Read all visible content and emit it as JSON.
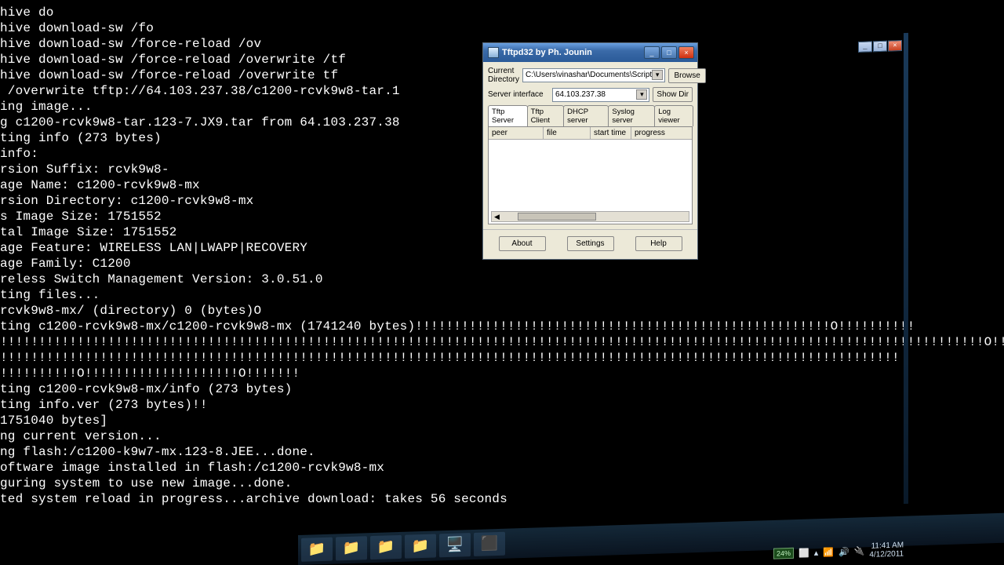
{
  "terminal_lines": [
    "hive do",
    "hive download-sw /fo",
    "hive download-sw /force-reload /ov",
    "hive download-sw /force-reload /overwrite /tf",
    "hive download-sw /force-reload /overwrite tf",
    " /overwrite tftp://64.103.237.38/c1200-rcvk9w8-tar.1",
    "ing image...",
    "g c1200-rcvk9w8-tar.123-7.JX9.tar from 64.103.237.38",
    "ting info (273 bytes)",
    "info:",
    "rsion Suffix: rcvk9w8-",
    "age Name: c1200-rcvk9w8-mx",
    "rsion Directory: c1200-rcvk9w8-mx",
    "s Image Size: 1751552",
    "tal Image Size: 1751552",
    "age Feature: WIRELESS LAN|LWAPP|RECOVERY",
    "age Family: C1200",
    "reless Switch Management Version: 3.0.51.0",
    "ting files...",
    "rcvk9w8-mx/ (directory) 0 (bytes)O",
    "ting c1200-rcvk9w8-mx/c1200-rcvk9w8-mx (1741240 bytes)!!!!!!!!!!!!!!!!!!!!!!!!!!!!!!!!!!!!!!!!!!!!!!!!!!!!!!O!!!!!!!!!!",
    "!!!!!!!!!!!!!!!!!!!!!!!!!!!!!!!!!!!!!!!!!!!!!!!!!!!!!!!!!!!!!!!!!!!!!!!!!!!!!!!!!!!!!!!!!!!!!!!!!!!!!!!!!!!!!!!!!!!!!!!!!!!!!!!!O!!!!!!!",
    "!!!!!!!!!!!!!!!!!!!!!!!!!!!!!!!!!!!!!!!!!!!!!!!!!!!!!!!!!!!!!!!!!!!!!!!!!!!!!!!!!!!!!!!!!!!!!!!!!!!!!!!!!!!!!!!!!!!!!",
    "!!!!!!!!!!O!!!!!!!!!!!!!!!!!!!!O!!!!!!!",
    "ting c1200-rcvk9w8-mx/info (273 bytes)",
    "ting info.ver (273 bytes)!!",
    "1751040 bytes]",
    "",
    "ng current version...",
    "ng flash:/c1200-k9w7-mx.123-8.JEE...done.",
    "oftware image installed in flash:/c1200-rcvk9w8-mx",
    "guring system to use new image...done.",
    "ted system reload in progress...archive download: takes 56 seconds"
  ],
  "dialog": {
    "title": "Tftpd32 by Ph. Jounin",
    "current_directory_label": "Current Directory",
    "current_directory_value": "C:\\Users\\vinashar\\Documents\\Script",
    "server_interface_label": "Server interface",
    "server_interface_value": "64.103.237.38",
    "browse": "Browse",
    "show_dir": "Show Dir",
    "tabs": {
      "tftp_server": "Tftp Server",
      "tftp_client": "Tftp Client",
      "dhcp_server": "DHCP server",
      "syslog_server": "Syslog server",
      "log_viewer": "Log viewer"
    },
    "columns": {
      "peer": "peer",
      "file": "file",
      "start_time": "start time",
      "progress": "progress"
    },
    "about": "About",
    "settings": "Settings",
    "help": "Help"
  },
  "tray": {
    "battery": "24%",
    "time": "11:41 AM",
    "date": "4/12/2011"
  }
}
